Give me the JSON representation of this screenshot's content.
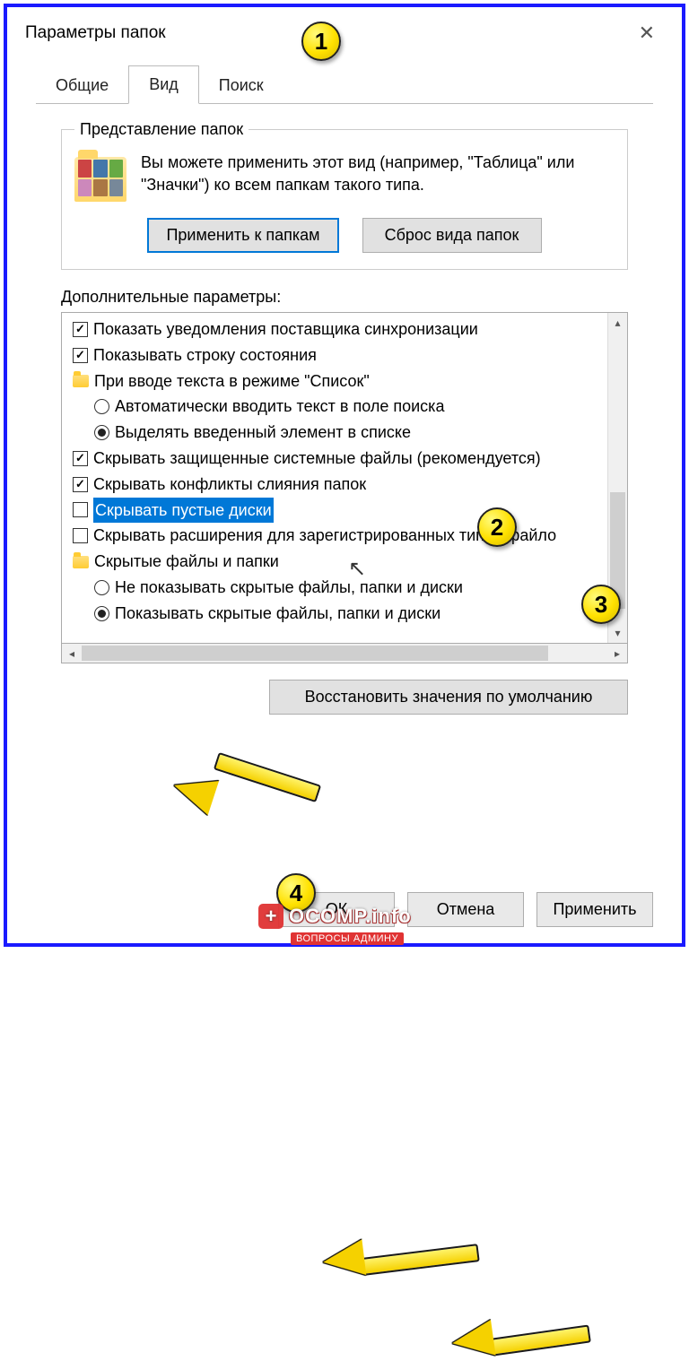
{
  "window": {
    "title": "Параметры папок",
    "close_label": "✕"
  },
  "tabs": {
    "general": "Общие",
    "view": "Вид",
    "search": "Поиск"
  },
  "folder_view": {
    "legend": "Представление папок",
    "description": "Вы можете применить этот вид (например, \"Таблица\" или \"Значки\") ко всем папкам такого типа.",
    "apply_btn": "Применить к папкам",
    "reset_btn": "Сброс вида папок"
  },
  "advanced": {
    "label": "Дополнительные параметры:",
    "items": {
      "sync_notifications": "Показать уведомления поставщика синхронизации",
      "status_bar": "Показывать строку состояния",
      "typing_group": "При вводе текста в режиме \"Список\"",
      "typing_search": "Автоматически вводить текст в поле поиска",
      "typing_select": "Выделять введенный элемент в списке",
      "hide_protected": "Скрывать защищенные системные файлы (рекомендуется)",
      "hide_merge": "Скрывать конфликты слияния папок",
      "hide_empty_drives": "Скрывать пустые диски",
      "hide_extensions": "Скрывать расширения для зарегистрированных типов файло",
      "hidden_group": "Скрытые файлы и папки",
      "hidden_hide": "Не показывать скрытые файлы, папки и диски",
      "hidden_show": "Показывать скрытые файлы, папки и диски"
    }
  },
  "restore_defaults": "Восстановить значения по умолчанию",
  "dialog_buttons": {
    "ok": "ОК",
    "cancel": "Отмена",
    "apply": "Применить"
  },
  "annotations": {
    "b1": "1",
    "b2": "2",
    "b3": "3",
    "b4": "4"
  },
  "watermark": {
    "main": "OCOMP.info",
    "sub": "ВОПРОСЫ АДМИНУ"
  }
}
